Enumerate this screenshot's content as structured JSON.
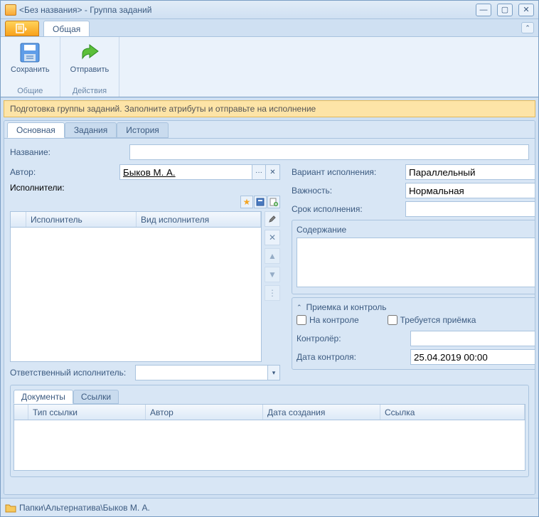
{
  "window": {
    "title": "<Без названия> - Группа заданий"
  },
  "ribbon": {
    "app_menu": "Меню",
    "tab_general": "Общая",
    "save": "Сохранить",
    "send": "Отправить",
    "group_general": "Общие",
    "group_actions": "Действия"
  },
  "notice": "Подготовка группы заданий. Заполните атрибуты и отправьте на исполнение",
  "tabs": {
    "main": "Основная",
    "tasks": "Задания",
    "history": "История"
  },
  "form": {
    "name_label": "Название:",
    "name_value": "",
    "author_label": "Автор:",
    "author_value": "Быков М. А.",
    "executors_label": "Исполнители:",
    "grid": {
      "col_num": "",
      "col_executor": "Исполнитель",
      "col_kind": "Вид исполнителя"
    },
    "resp_label": "Ответственный исполнитель:",
    "resp_value": "",
    "variant_label": "Вариант исполнения:",
    "variant_value": "Параллельный",
    "importance_label": "Важность:",
    "importance_value": "Нормальная",
    "due_label": "Срок исполнения:",
    "due_value": "",
    "content_legend": "Содержание",
    "content_value": "",
    "accept_legend": "Приемка и контроль",
    "on_control": "На контроле",
    "need_accept": "Требуется приёмка",
    "controller_label": "Контролёр:",
    "controller_value": "",
    "control_date_label": "Дата контроля:",
    "control_date_value": "25.04.2019 00:00"
  },
  "docs": {
    "tab_docs": "Документы",
    "tab_links": "Ссылки",
    "col_type": "Тип ссылки",
    "col_author": "Автор",
    "col_date": "Дата создания",
    "col_link": "Ссылка"
  },
  "status": {
    "path": "Папки\\Альтернатива\\Быков М. А."
  }
}
